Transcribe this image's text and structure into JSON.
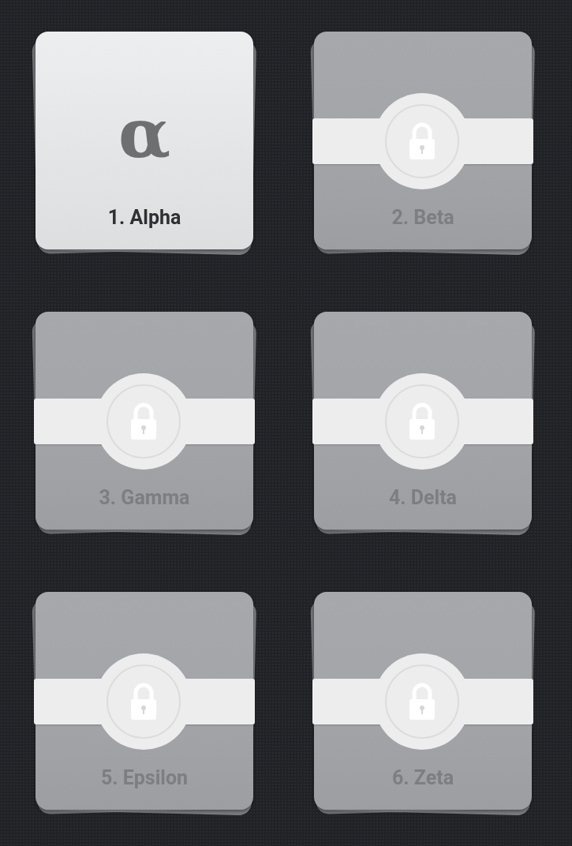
{
  "levels": [
    {
      "label": "1. Alpha",
      "symbol": "α",
      "locked": false
    },
    {
      "label": "2. Beta",
      "locked": true
    },
    {
      "label": "3. Gamma",
      "locked": true
    },
    {
      "label": "4. Delta",
      "locked": true
    },
    {
      "label": "5. Epsilon",
      "locked": true
    },
    {
      "label": "6. Zeta",
      "locked": true
    }
  ]
}
